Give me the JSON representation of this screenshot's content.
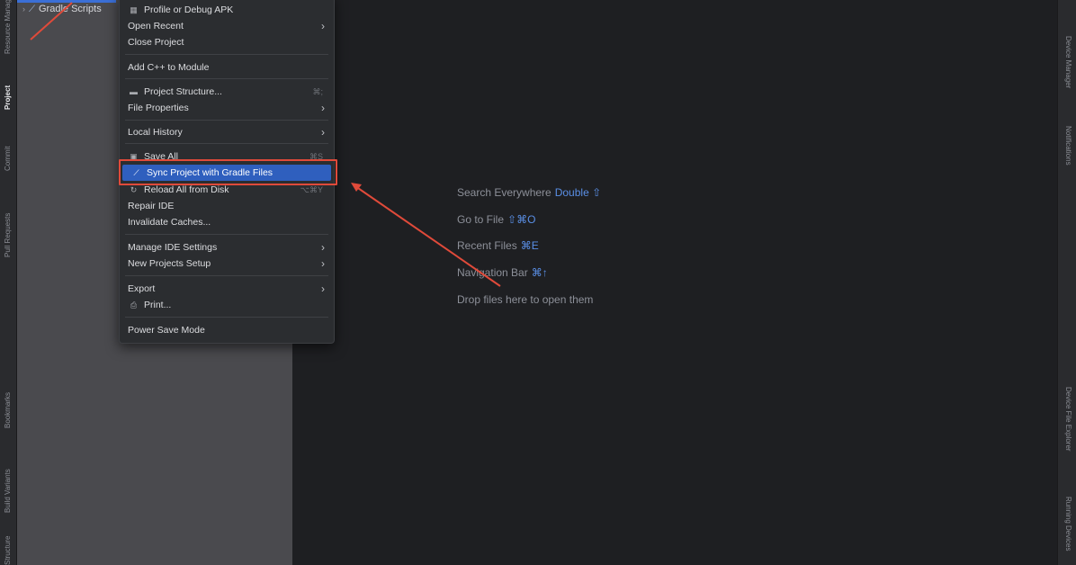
{
  "left_strip": {
    "items": [
      "Resource Manager",
      "Project",
      "Commit",
      "Pull Requests",
      "Bookmarks",
      "Build Variants",
      "Structure"
    ]
  },
  "right_strip": {
    "items": [
      "Device Manager",
      "Notifications",
      "Device File Explorer",
      "Running Devices"
    ]
  },
  "project_panel": {
    "tree_item": "Gradle Scripts"
  },
  "menu": {
    "items": [
      {
        "label": "Profile or Debug APK",
        "icon": "apk-icon"
      },
      {
        "label": "Open Recent",
        "submenu": true
      },
      {
        "label": "Close Project"
      },
      {
        "label": "Add C++ to Module"
      },
      {
        "label": "Project Structure...",
        "icon": "folder-icon",
        "shortcut": "⌘;"
      },
      {
        "label": "File Properties",
        "submenu": true
      },
      {
        "label": "Local History",
        "submenu": true
      },
      {
        "label": "Save All",
        "icon": "save-icon",
        "shortcut": "⌘S"
      },
      {
        "label": "Sync Project with Gradle Files",
        "icon": "gradle-sync-icon",
        "highlighted": true
      },
      {
        "label": "Reload All from Disk",
        "icon": "reload-icon",
        "shortcut": "⌥⌘Y"
      },
      {
        "label": "Repair IDE"
      },
      {
        "label": "Invalidate Caches..."
      },
      {
        "label": "Manage IDE Settings",
        "submenu": true
      },
      {
        "label": "New Projects Setup",
        "submenu": true
      },
      {
        "label": "Export",
        "submenu": true
      },
      {
        "label": "Print...",
        "icon": "print-icon"
      },
      {
        "label": "Power Save Mode"
      }
    ]
  },
  "editor_hints": [
    {
      "label": "Search Everywhere",
      "key": "Double ⇧"
    },
    {
      "label": "Go to File",
      "key": "⇧⌘O"
    },
    {
      "label": "Recent Files",
      "key": "⌘E"
    },
    {
      "label": "Navigation Bar",
      "key": "⌘↑"
    },
    {
      "label": "Drop files here to open them",
      "key": ""
    }
  ],
  "colors": {
    "highlight": "#2f5fbe",
    "annotation": "#e04a3a",
    "key_hint": "#5a8fe6"
  }
}
